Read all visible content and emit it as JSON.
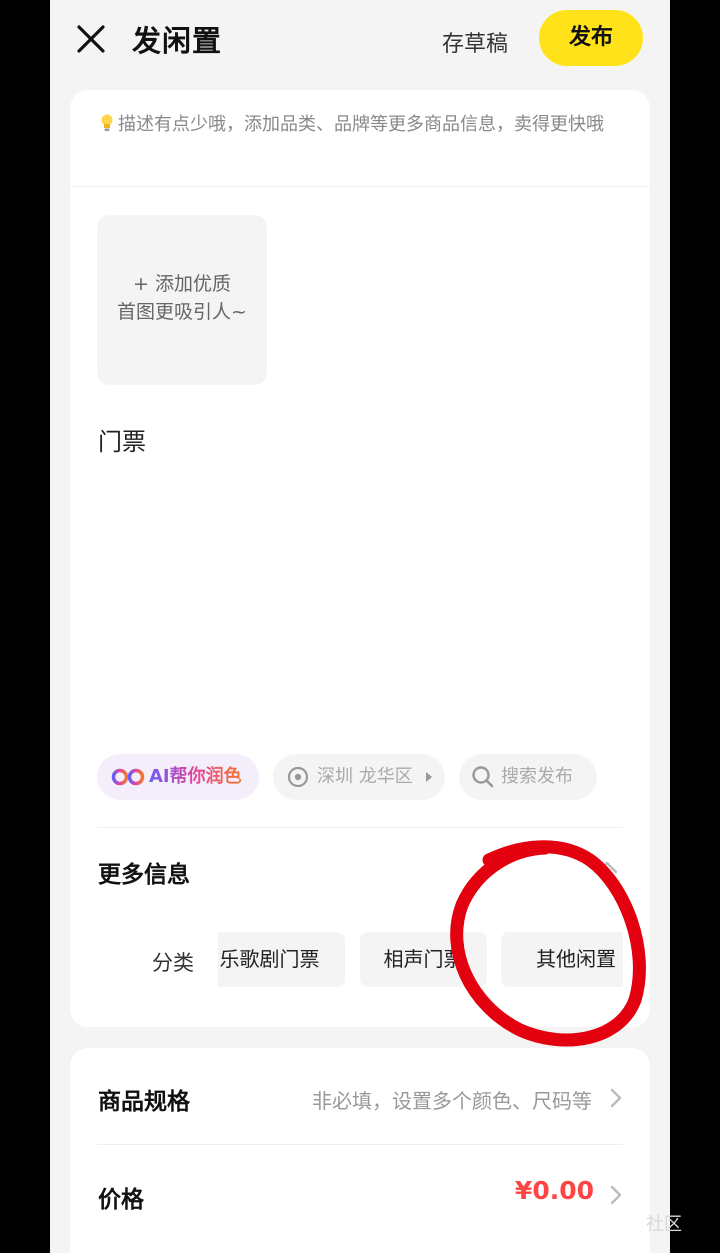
{
  "header": {
    "title": "发闲置",
    "draft_label": "存草稿",
    "publish_label": "发布"
  },
  "tip": {
    "icon": "lightbulb-icon",
    "text": "描述有点少哦，添加品类、品牌等更多商品信息，卖得更快哦"
  },
  "photo": {
    "line1": "+ 添加优质",
    "line2": "首图更吸引人~"
  },
  "description": {
    "value": "门票"
  },
  "tools": {
    "ai_label": "AI帮你润色",
    "location_label": "深圳 龙华区",
    "search_label": "搜索发布"
  },
  "more_info": {
    "title": "更多信息",
    "category_label": "分类",
    "category_options": [
      "乐歌剧门票",
      "相声门票",
      "其他闲置"
    ]
  },
  "spec": {
    "label": "商品规格",
    "value": "非必填，设置多个颜色、尺码等"
  },
  "price": {
    "label": "价格",
    "value": "¥0.00"
  },
  "watermark": "社区",
  "colors": {
    "accent": "#ffe21a",
    "price": "#ff4444",
    "annotation": "#e3000f"
  }
}
